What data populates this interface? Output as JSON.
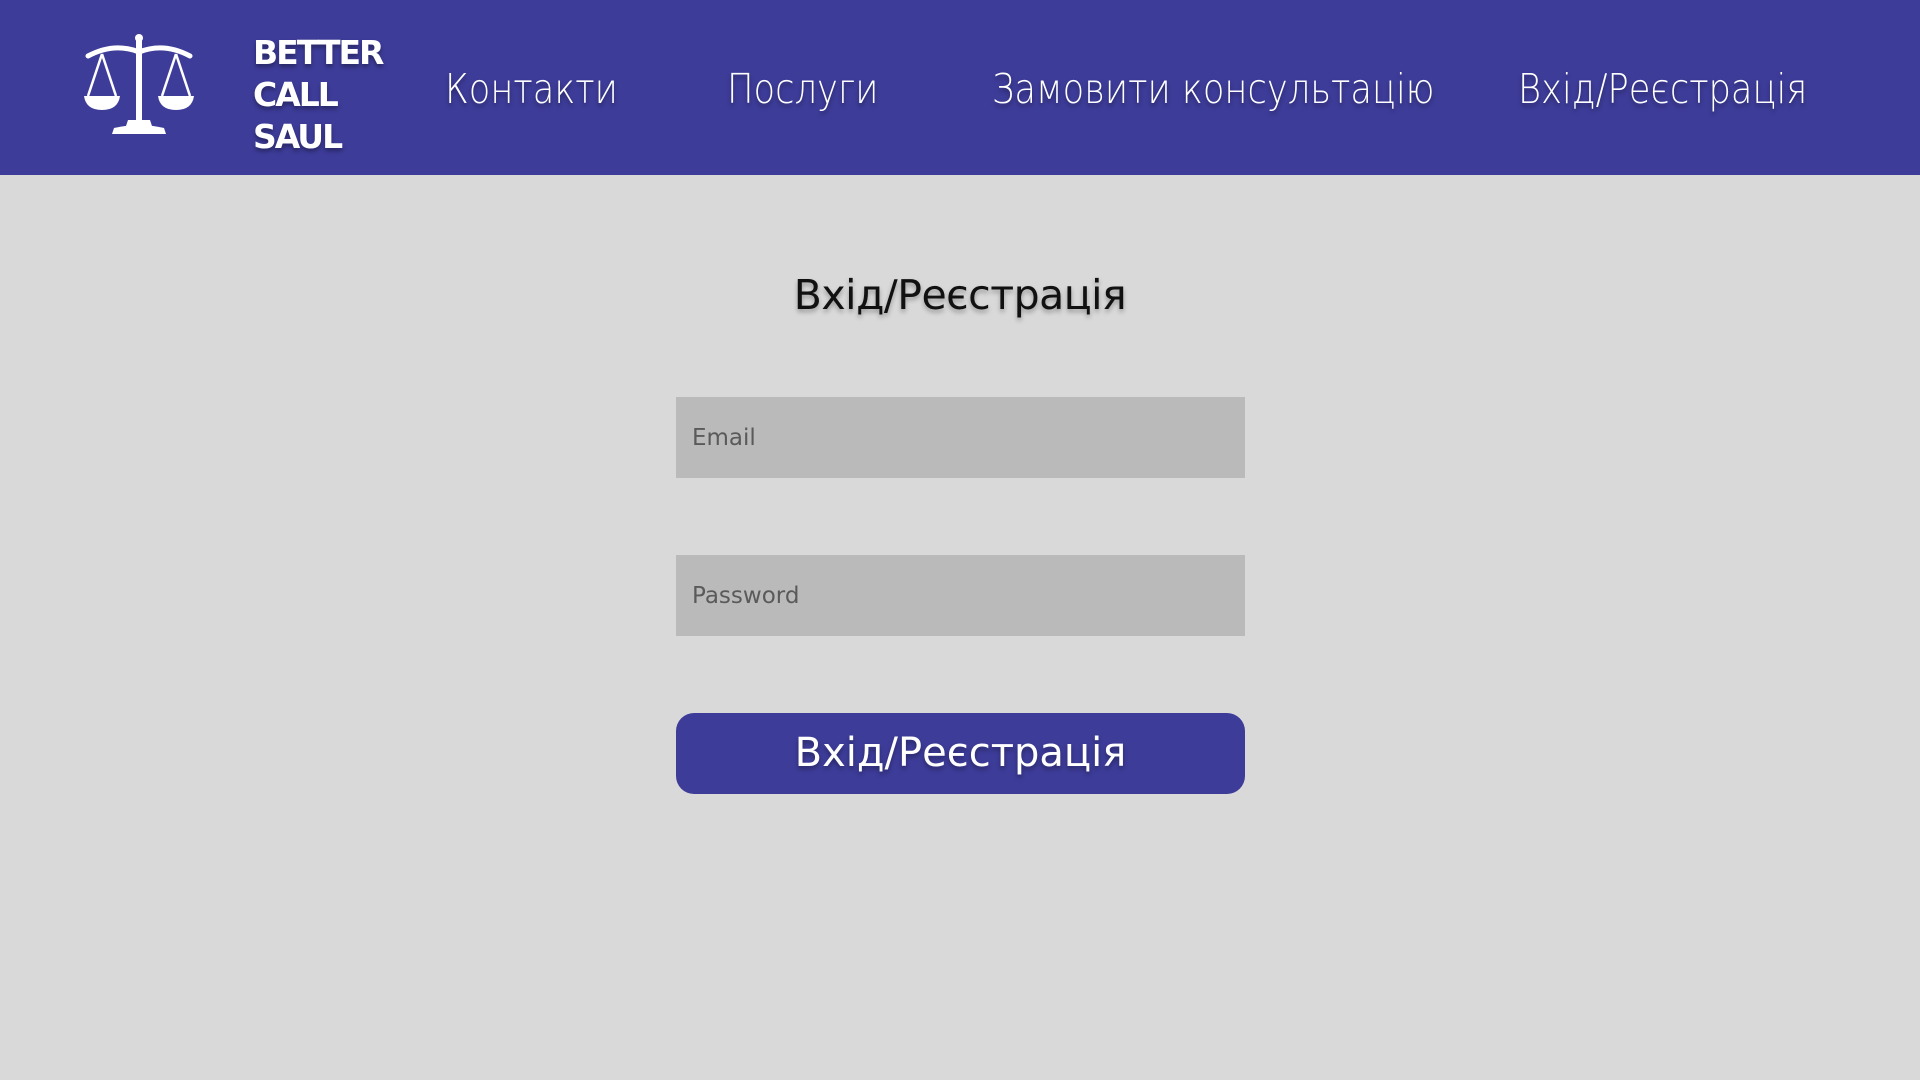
{
  "colors": {
    "header_bg": "#3d3c99",
    "page_bg": "#d9d9d9",
    "input_bg": "#bababa",
    "button_bg": "#3d3c99",
    "header_text": "#ffffff"
  },
  "header": {
    "logo": {
      "icon": "scales-of-justice-icon",
      "line1": "BETTER",
      "line2": "CALL",
      "line3": "SAUL"
    },
    "nav": {
      "contacts": "Контакти",
      "services": "Послуги",
      "consultation": "Замовити консультацію",
      "login": "Вхід/Реєстрація"
    }
  },
  "form": {
    "title": "Вхід/Реєстрація",
    "email": {
      "placeholder": "Email",
      "value": ""
    },
    "password": {
      "placeholder": "Password",
      "value": ""
    },
    "submit_label": "Вхід/Реєстрація"
  }
}
